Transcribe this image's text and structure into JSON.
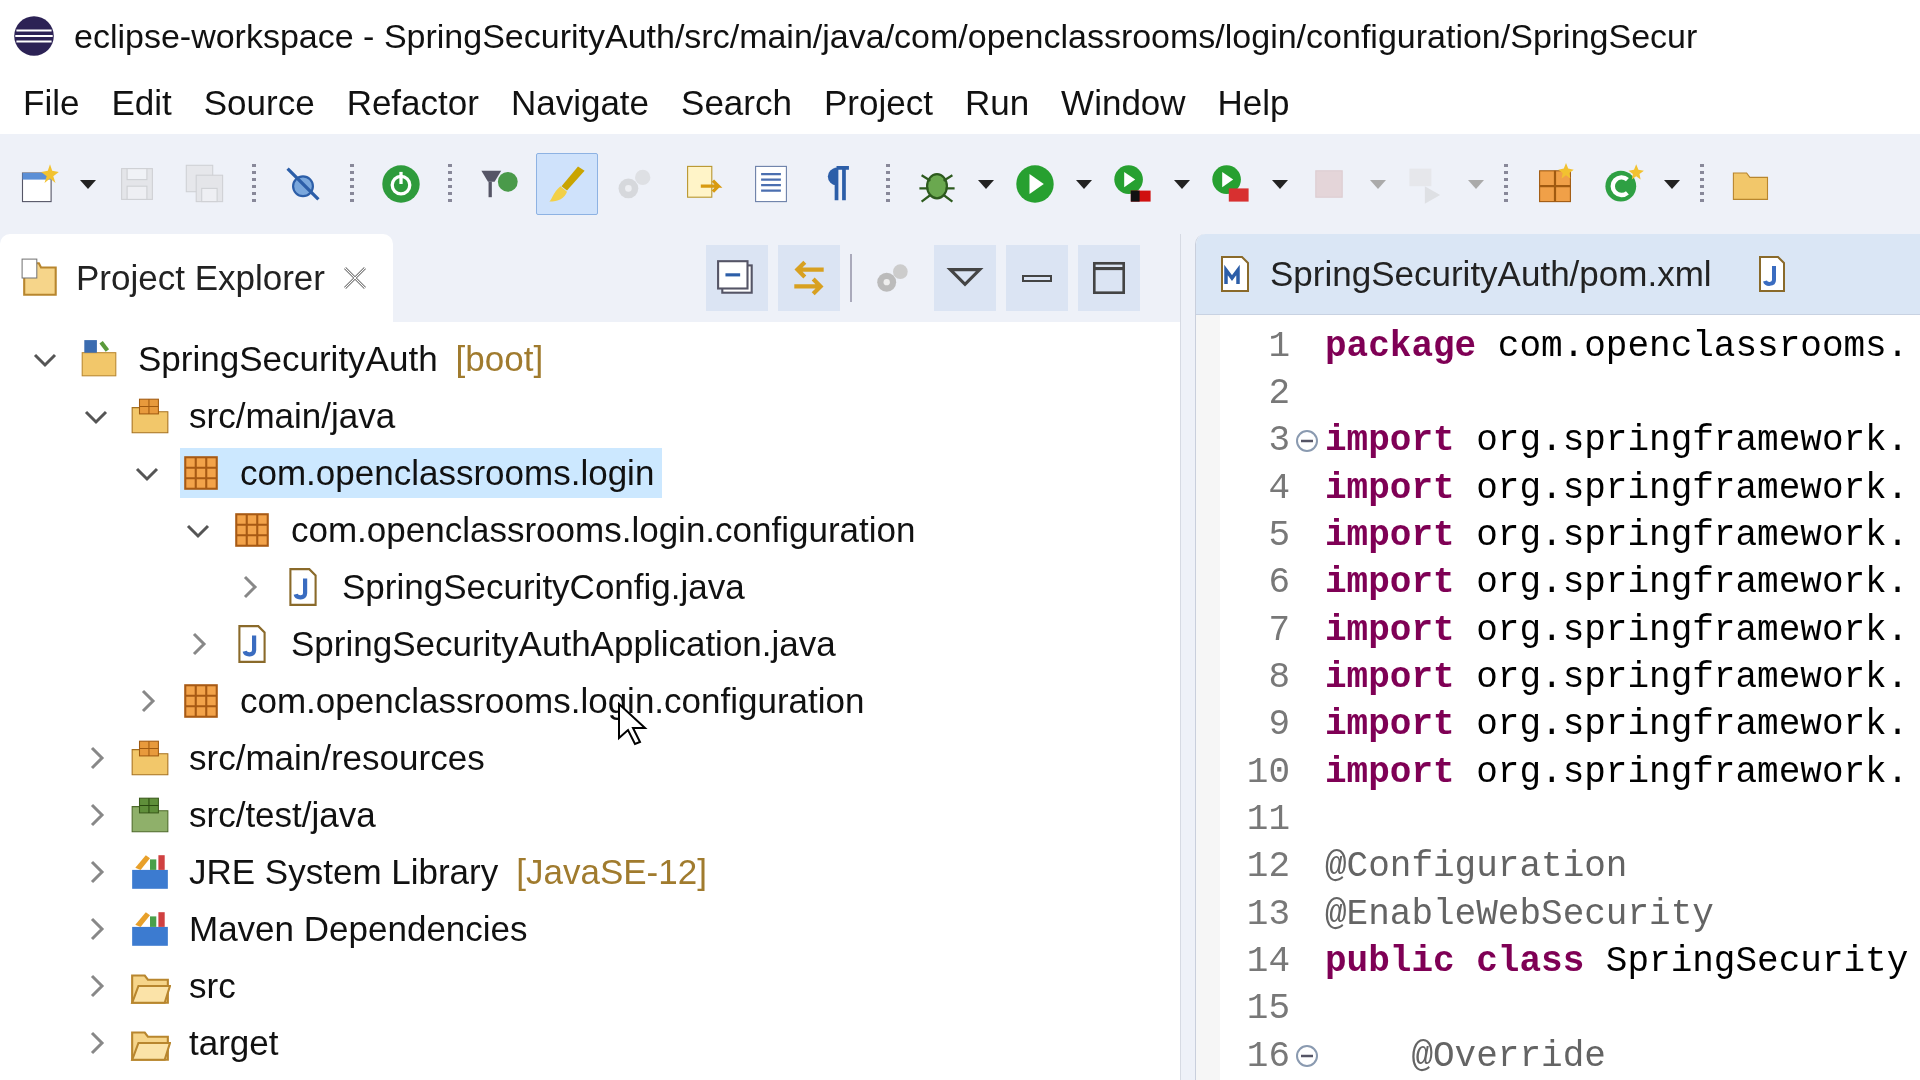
{
  "window": {
    "title": "eclipse-workspace - SpringSecurityAuth/src/main/java/com/openclassrooms/login/configuration/SpringSecur"
  },
  "menu": [
    "File",
    "Edit",
    "Source",
    "Refactor",
    "Navigate",
    "Search",
    "Project",
    "Run",
    "Window",
    "Help"
  ],
  "toolbar": [
    {
      "kind": "new",
      "disabled": false,
      "pressed": false,
      "dropdown": true
    },
    {
      "kind": "save",
      "disabled": true,
      "pressed": false,
      "dropdown": false
    },
    {
      "kind": "save-all",
      "disabled": true,
      "pressed": false,
      "dropdown": false
    },
    {
      "kind": "separator"
    },
    {
      "kind": "skip-breakpoints",
      "disabled": false,
      "pressed": false,
      "dropdown": false
    },
    {
      "kind": "separator"
    },
    {
      "kind": "power",
      "disabled": false,
      "pressed": false,
      "dropdown": false
    },
    {
      "kind": "separator"
    },
    {
      "kind": "open-type",
      "disabled": false,
      "pressed": false,
      "dropdown": false
    },
    {
      "kind": "brush",
      "disabled": false,
      "pressed": true,
      "dropdown": false
    },
    {
      "kind": "gears",
      "disabled": true,
      "pressed": false,
      "dropdown": false
    },
    {
      "kind": "annotation",
      "disabled": false,
      "pressed": false,
      "dropdown": false
    },
    {
      "kind": "block",
      "disabled": false,
      "pressed": false,
      "dropdown": false
    },
    {
      "kind": "pilcrow",
      "disabled": false,
      "pressed": false,
      "dropdown": false
    },
    {
      "kind": "separator"
    },
    {
      "kind": "bug",
      "disabled": false,
      "pressed": false,
      "dropdown": true
    },
    {
      "kind": "run",
      "disabled": false,
      "pressed": false,
      "dropdown": true
    },
    {
      "kind": "coverage",
      "disabled": false,
      "pressed": false,
      "dropdown": true
    },
    {
      "kind": "external-tools",
      "disabled": false,
      "pressed": false,
      "dropdown": true
    },
    {
      "kind": "stop",
      "disabled": true,
      "pressed": false,
      "dropdown": true
    },
    {
      "kind": "disconnect",
      "disabled": true,
      "pressed": false,
      "dropdown": true
    },
    {
      "kind": "separator"
    },
    {
      "kind": "new-package",
      "disabled": false,
      "pressed": false,
      "dropdown": false
    },
    {
      "kind": "new-class",
      "disabled": false,
      "pressed": false,
      "dropdown": true
    },
    {
      "kind": "separator"
    },
    {
      "kind": "open-folder",
      "disabled": false,
      "pressed": false,
      "dropdown": false
    }
  ],
  "explorer": {
    "title": "Project Explorer",
    "tree": [
      {
        "kind": "project",
        "label": "SpringSecurityAuth",
        "decoration": "[boot]",
        "expanded": true,
        "selected": false,
        "children": [
          {
            "kind": "source-folder",
            "label": "src/main/java",
            "expanded": true,
            "selected": false,
            "children": [
              {
                "kind": "package",
                "label": "com.openclassrooms.login",
                "expanded": true,
                "selected": true,
                "children": [
                  {
                    "kind": "package",
                    "label": "com.openclassrooms.login.configuration",
                    "expanded": true,
                    "selected": false,
                    "children": [
                      {
                        "kind": "java-file",
                        "label": "SpringSecurityConfig.java",
                        "expanded": false,
                        "selected": false
                      }
                    ]
                  },
                  {
                    "kind": "java-file",
                    "label": "SpringSecurityAuthApplication.java",
                    "expanded": false,
                    "selected": false
                  }
                ]
              },
              {
                "kind": "package",
                "label": "com.openclassrooms.login.configuration",
                "expanded": false,
                "selected": false
              }
            ]
          },
          {
            "kind": "source-folder",
            "label": "src/main/resources",
            "expanded": false,
            "selected": false
          },
          {
            "kind": "test-folder",
            "label": "src/test/java",
            "expanded": false,
            "selected": false
          },
          {
            "kind": "library",
            "label": "JRE System Library",
            "decoration": "[JavaSE-12]",
            "expanded": false,
            "selected": false
          },
          {
            "kind": "library",
            "label": "Maven Dependencies",
            "expanded": false,
            "selected": false
          },
          {
            "kind": "folder",
            "label": "src",
            "expanded": false,
            "selected": false
          },
          {
            "kind": "folder",
            "label": "target",
            "expanded": false,
            "selected": false
          }
        ]
      }
    ]
  },
  "editor": {
    "tabs": [
      {
        "kind": "maven",
        "label": "SpringSecurityAuth/pom.xml"
      },
      {
        "kind": "java"
      }
    ],
    "lines": [
      {
        "number": "1",
        "fold": false,
        "tokens": [
          {
            "kind": "keyword",
            "text": "package"
          },
          {
            "kind": "plain",
            "text": " com.openclassrooms."
          }
        ]
      },
      {
        "number": "2",
        "fold": false
      },
      {
        "number": "3",
        "fold": true,
        "tokens": [
          {
            "kind": "keyword",
            "text": "import"
          },
          {
            "kind": "plain",
            "text": " org.springframework."
          }
        ]
      },
      {
        "number": "4",
        "fold": false,
        "tokens": [
          {
            "kind": "keyword",
            "text": "import"
          },
          {
            "kind": "plain",
            "text": " org.springframework."
          }
        ]
      },
      {
        "number": "5",
        "fold": false,
        "tokens": [
          {
            "kind": "keyword",
            "text": "import"
          },
          {
            "kind": "plain",
            "text": " org.springframework."
          }
        ]
      },
      {
        "number": "6",
        "fold": false,
        "tokens": [
          {
            "kind": "keyword",
            "text": "import"
          },
          {
            "kind": "plain",
            "text": " org.springframework."
          }
        ]
      },
      {
        "number": "7",
        "fold": false,
        "tokens": [
          {
            "kind": "keyword",
            "text": "import"
          },
          {
            "kind": "plain",
            "text": " org.springframework."
          }
        ]
      },
      {
        "number": "8",
        "fold": false,
        "tokens": [
          {
            "kind": "keyword",
            "text": "import"
          },
          {
            "kind": "plain",
            "text": " org.springframework."
          }
        ]
      },
      {
        "number": "9",
        "fold": false,
        "tokens": [
          {
            "kind": "keyword",
            "text": "import"
          },
          {
            "kind": "plain",
            "text": " org.springframework."
          }
        ]
      },
      {
        "number": "10",
        "fold": false,
        "tokens": [
          {
            "kind": "keyword",
            "text": "import"
          },
          {
            "kind": "plain",
            "text": " org.springframework."
          }
        ]
      },
      {
        "number": "11",
        "fold": false
      },
      {
        "number": "12",
        "fold": false,
        "tokens": [
          {
            "kind": "annotation",
            "text": "@Configuration"
          }
        ]
      },
      {
        "number": "13",
        "fold": false,
        "tokens": [
          {
            "kind": "annotation",
            "text": "@EnableWebSecurity"
          }
        ]
      },
      {
        "number": "14",
        "fold": false,
        "tokens": [
          {
            "kind": "keyword",
            "text": "public class"
          },
          {
            "kind": "plain",
            "text": " SpringSecurity"
          }
        ]
      },
      {
        "number": "15",
        "fold": false
      },
      {
        "number": "16",
        "fold": true,
        "tokens": [
          {
            "kind": "annotation",
            "text": "    @Override"
          }
        ]
      }
    ]
  }
}
